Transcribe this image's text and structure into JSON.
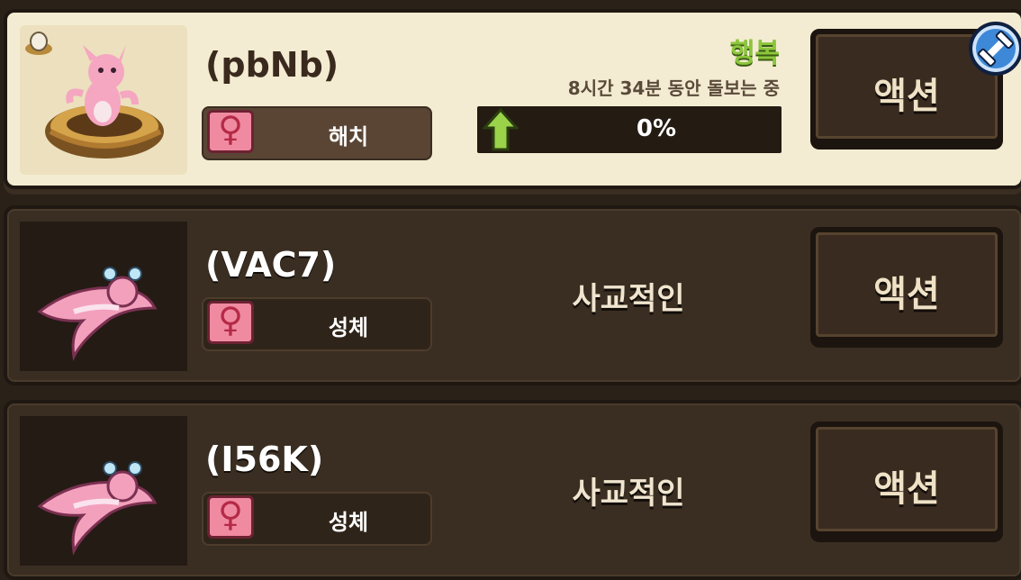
{
  "pets": [
    {
      "name": "(pbNb)",
      "stage": "해치",
      "mood": "행복",
      "care_time": "8시간 34분 동안 돌보는 중",
      "progress_label": "0%",
      "progress_value": 0,
      "action_label": "액션",
      "icons": [
        "egg-icon",
        "female-icon",
        "up-arrow-icon",
        "dumbbell-icon"
      ]
    },
    {
      "name": "(VAC7)",
      "stage": "성체",
      "status": "사교적인",
      "action_label": "액션",
      "icons": [
        "female-icon"
      ]
    },
    {
      "name": "(I56K)",
      "stage": "성체",
      "status": "사교적인",
      "action_label": "액션",
      "icons": [
        "female-icon"
      ]
    }
  ],
  "colors": {
    "mood_green": "#8cc63c",
    "card_active_bg": "#f4ecd2",
    "card_bg": "#3a2e22",
    "female_pink": "#f08aa1"
  }
}
